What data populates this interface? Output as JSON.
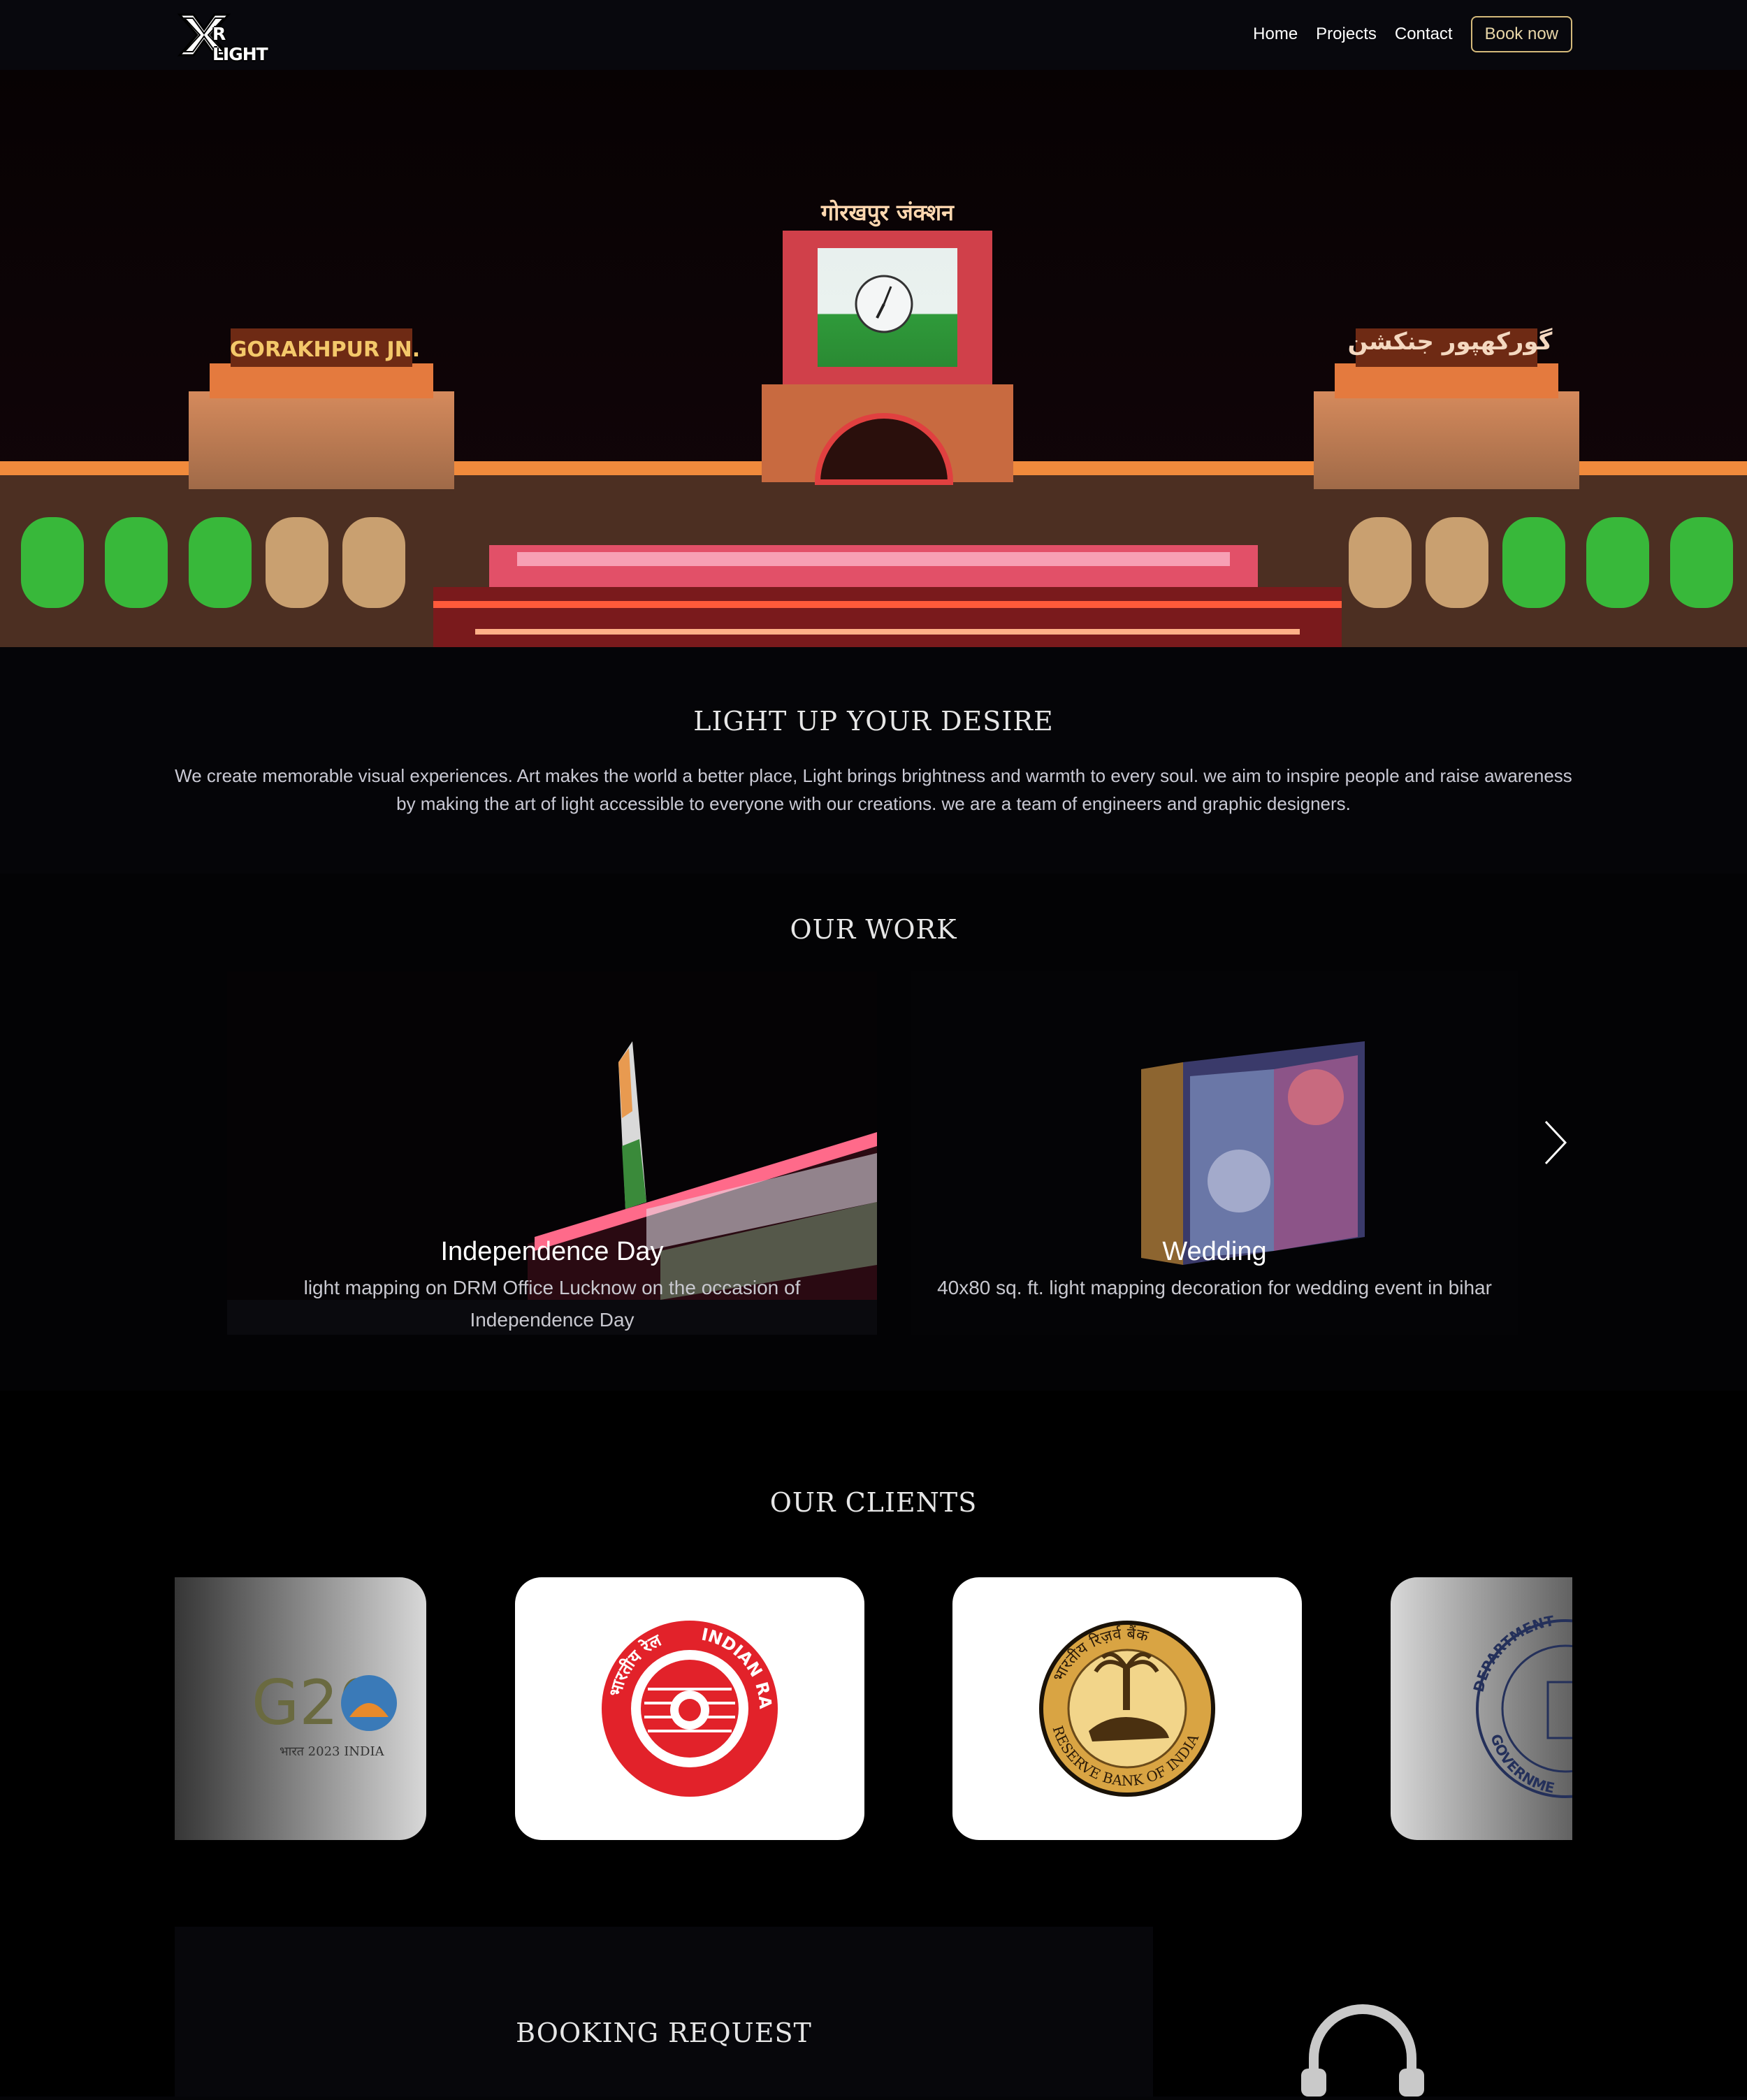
{
  "nav": {
    "logo_text": "R LIGHT",
    "links": [
      "Home",
      "Projects",
      "Contact"
    ],
    "book_label": "Book now"
  },
  "hero": {
    "signs": {
      "left": "GORAKHPUR JN.",
      "center": "गोरखपुर जंक्शन",
      "right": "گورکھپور جنکشن"
    }
  },
  "intro": {
    "title": "LIGHT UP YOUR DESIRE",
    "text": "We create memorable visual experiences. Art makes the world a better place, Light brings brightness and warmth to every soul. we aim to inspire people and raise awareness by making the art of light accessible to everyone with our creations. we are a team of engineers and graphic designers."
  },
  "work": {
    "title": "OUR WORK",
    "cards": [
      {
        "title": "Independence Day",
        "desc": "light mapping on DRM Office Lucknow on the occasion of Independence Day"
      },
      {
        "title": "Wedding",
        "desc": "40x80 sq. ft. light mapping decoration for wedding event in bihar"
      }
    ]
  },
  "clients": {
    "title": "OUR CLIENTS",
    "logos": [
      {
        "name": "g20-logo-icon",
        "text": "G20",
        "subtext": "भारत 2023 INDIA"
      },
      {
        "name": "indian-railways-logo-icon",
        "text": "INDIAN RAILWAYS",
        "hindi": "भारतीय रेल"
      },
      {
        "name": "rbi-logo-icon",
        "text": "RESERVE BANK OF INDIA",
        "hindi": "भारतीय रिज़र्व बैंक"
      },
      {
        "name": "department-seal-icon",
        "text": "DEPARTMENT",
        "subtext": "GOVERNME"
      }
    ]
  },
  "booking": {
    "title": "BOOKING REQUEST"
  },
  "colors": {
    "accent": "#d4b97a",
    "railways_red": "#e2222a",
    "rbi_gold": "#d9a443"
  }
}
